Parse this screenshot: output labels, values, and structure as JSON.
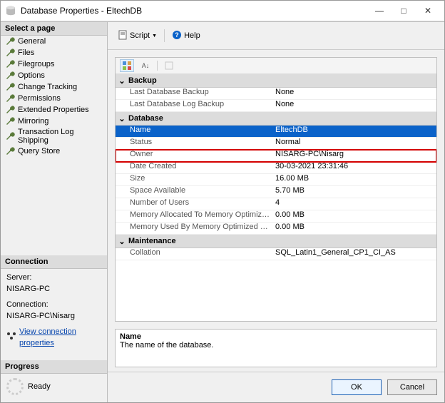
{
  "window": {
    "title": "Database Properties - EltechDB",
    "min": "—",
    "max": "□",
    "close": "✕"
  },
  "sidebar": {
    "selectPage": "Select a page",
    "pages": [
      "General",
      "Files",
      "Filegroups",
      "Options",
      "Change Tracking",
      "Permissions",
      "Extended Properties",
      "Mirroring",
      "Transaction Log Shipping",
      "Query Store"
    ],
    "connectionHead": "Connection",
    "serverLabel": "Server:",
    "serverVal": "NISARG-PC",
    "connLabel": "Connection:",
    "connVal": "NISARG-PC\\Nisarg",
    "viewConn": "View connection properties",
    "progressHead": "Progress",
    "ready": "Ready"
  },
  "toolbar": {
    "script": "Script",
    "help": "Help"
  },
  "grid": {
    "cats": [
      {
        "name": "Backup",
        "rows": [
          {
            "label": "Last Database Backup",
            "value": "None"
          },
          {
            "label": "Last Database Log Backup",
            "value": "None"
          }
        ]
      },
      {
        "name": "Database",
        "rows": [
          {
            "label": "Name",
            "value": "EltechDB",
            "selected": true
          },
          {
            "label": "Status",
            "value": "Normal"
          },
          {
            "label": "Owner",
            "value": "NISARG-PC\\Nisarg",
            "highlight": true
          },
          {
            "label": "Date Created",
            "value": "30-03-2021 23:31:46"
          },
          {
            "label": "Size",
            "value": "16.00 MB"
          },
          {
            "label": "Space Available",
            "value": "5.70 MB"
          },
          {
            "label": "Number of Users",
            "value": "4"
          },
          {
            "label": "Memory Allocated To Memory Optimized Obj",
            "value": "0.00 MB"
          },
          {
            "label": "Memory Used By Memory Optimized Objects",
            "value": "0.00 MB"
          }
        ]
      },
      {
        "name": "Maintenance",
        "rows": [
          {
            "label": "Collation",
            "value": "SQL_Latin1_General_CP1_CI_AS"
          }
        ]
      }
    ]
  },
  "desc": {
    "name": "Name",
    "text": "The name of the database."
  },
  "buttons": {
    "ok": "OK",
    "cancel": "Cancel"
  }
}
